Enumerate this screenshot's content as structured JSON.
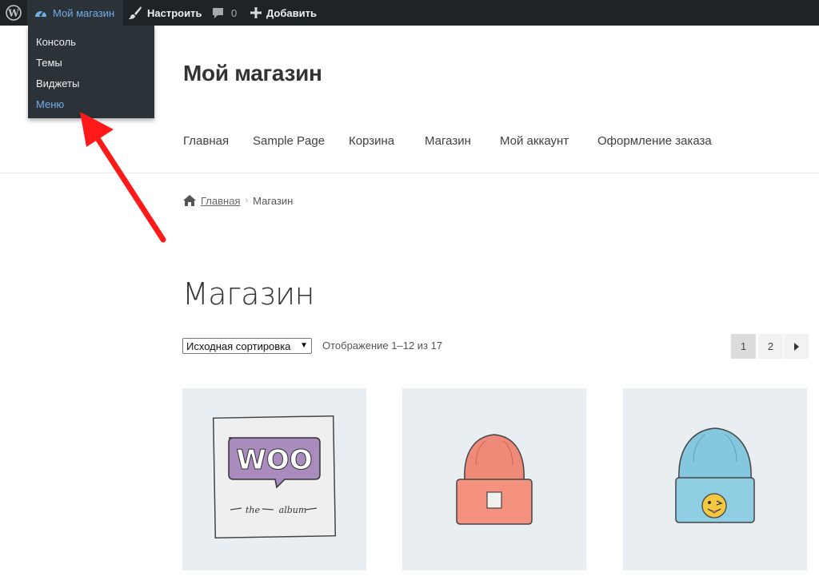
{
  "admin_bar": {
    "site_name": "Мой магазин",
    "customize": "Настроить",
    "comments_count": "0",
    "add_new": "Добавить"
  },
  "site_menu": {
    "items": [
      {
        "label": "Консоль"
      },
      {
        "label": "Темы"
      },
      {
        "label": "Виджеты"
      },
      {
        "label": "Меню"
      }
    ]
  },
  "header": {
    "site_title": "Мой магазин",
    "nav": [
      {
        "label": "Главная"
      },
      {
        "label": "Sample Page"
      },
      {
        "label": "Корзина"
      },
      {
        "label": "Магазин"
      },
      {
        "label": "Мой аккаунт"
      },
      {
        "label": "Оформление заказа"
      }
    ]
  },
  "breadcrumb": {
    "home": "Главная",
    "current": "Магазин"
  },
  "shop": {
    "title": "Магазин",
    "sort_selected": "Исходная сортировка",
    "result_count": "Отображение 1–12 из 17",
    "pages": [
      "1",
      "2"
    ]
  },
  "products": [
    {
      "image": "woo-album-cover",
      "text_top": "WOO",
      "text_bottom_left": "the",
      "text_bottom_right": "album"
    },
    {
      "image": "orange-beanie"
    },
    {
      "image": "blue-beanie-with-smiley"
    }
  ],
  "colors": {
    "admin_bar_bg": "#1d2327",
    "admin_submenu_bg": "#2c3338",
    "admin_highlight": "#72aee6",
    "annotation_arrow": "#ff1a1a",
    "product_bg": "#e9eef2"
  }
}
